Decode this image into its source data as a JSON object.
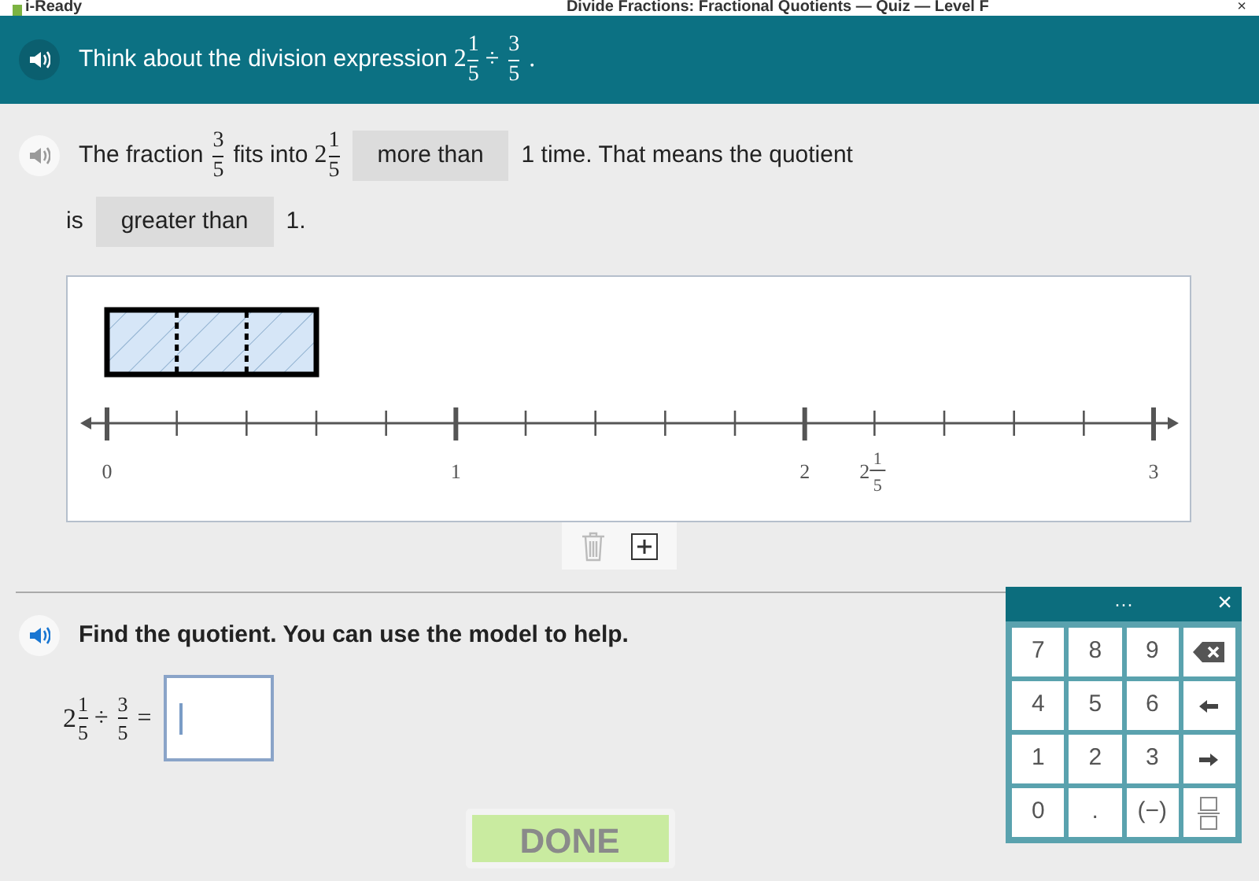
{
  "title_bar": {
    "logo": "i-Ready",
    "title": "Divide Fractions: Fractional Quotients — Quiz — Level F",
    "close": "×"
  },
  "banner": {
    "tokens": [
      {
        "kind": "text",
        "text": "Think about the division expression"
      },
      {
        "kind": "mixed",
        "whole": "2",
        "num": "1",
        "den": "5"
      },
      {
        "kind": "op",
        "text": "÷"
      },
      {
        "kind": "fraction",
        "num": "3",
        "den": "5"
      },
      {
        "kind": "op",
        "text": "."
      }
    ]
  },
  "statement": {
    "lines": [
      [
        {
          "kind": "text",
          "text": "The fraction"
        },
        {
          "kind": "fraction",
          "num": "3",
          "den": "5"
        },
        {
          "kind": "text",
          "text": "fits into"
        },
        {
          "kind": "mixed",
          "whole": "2",
          "num": "1",
          "den": "5"
        },
        {
          "kind": "blank",
          "text": "more than"
        },
        {
          "kind": "text",
          "text": "1 time. That means the quotient"
        }
      ],
      [
        {
          "kind": "text",
          "text": "is"
        },
        {
          "kind": "blank",
          "text": "greater than"
        },
        {
          "kind": "text",
          "text": "1."
        }
      ]
    ]
  },
  "model": {
    "tape": [
      {
        "shaded": true
      },
      {
        "shaded": true
      },
      {
        "shaded": true
      }
    ],
    "labels": [
      {
        "kind": "whole",
        "text": "0"
      },
      {
        "kind": "whole",
        "text": "1"
      },
      {
        "kind": "whole",
        "text": "2"
      },
      {
        "kind": "mixed",
        "whole": "2",
        "num": "1",
        "den": "5"
      },
      {
        "kind": "whole",
        "text": "3"
      }
    ]
  },
  "question": {
    "prompt": "Find the quotient. You can use the model to help.",
    "equation": [
      {
        "kind": "mixed",
        "whole": "2",
        "num": "1",
        "den": "5"
      },
      {
        "kind": "op",
        "text": "÷"
      },
      {
        "kind": "fraction",
        "num": "3",
        "den": "5"
      },
      {
        "kind": "op",
        "text": "="
      }
    ],
    "answer": {
      "placeholder_cursor": true
    }
  },
  "done_button": {
    "label": "DONE",
    "disabled": true
  },
  "keypad": {
    "handle": "···",
    "close": "×",
    "keys": [
      {
        "kind": "digit",
        "text": "7"
      },
      {
        "kind": "digit",
        "text": "8"
      },
      {
        "kind": "digit",
        "text": "9"
      },
      {
        "kind": "backspace"
      },
      {
        "kind": "digit",
        "text": "4"
      },
      {
        "kind": "digit",
        "text": "5"
      },
      {
        "kind": "digit",
        "text": "6"
      },
      {
        "kind": "left"
      },
      {
        "kind": "digit",
        "text": "1"
      },
      {
        "kind": "digit",
        "text": "2"
      },
      {
        "kind": "digit",
        "text": "3"
      },
      {
        "kind": "right"
      },
      {
        "kind": "digit",
        "text": "0"
      },
      {
        "kind": "digit",
        "text": "."
      },
      {
        "kind": "digit",
        "text": "(−)"
      },
      {
        "kind": "fraction"
      }
    ]
  }
}
